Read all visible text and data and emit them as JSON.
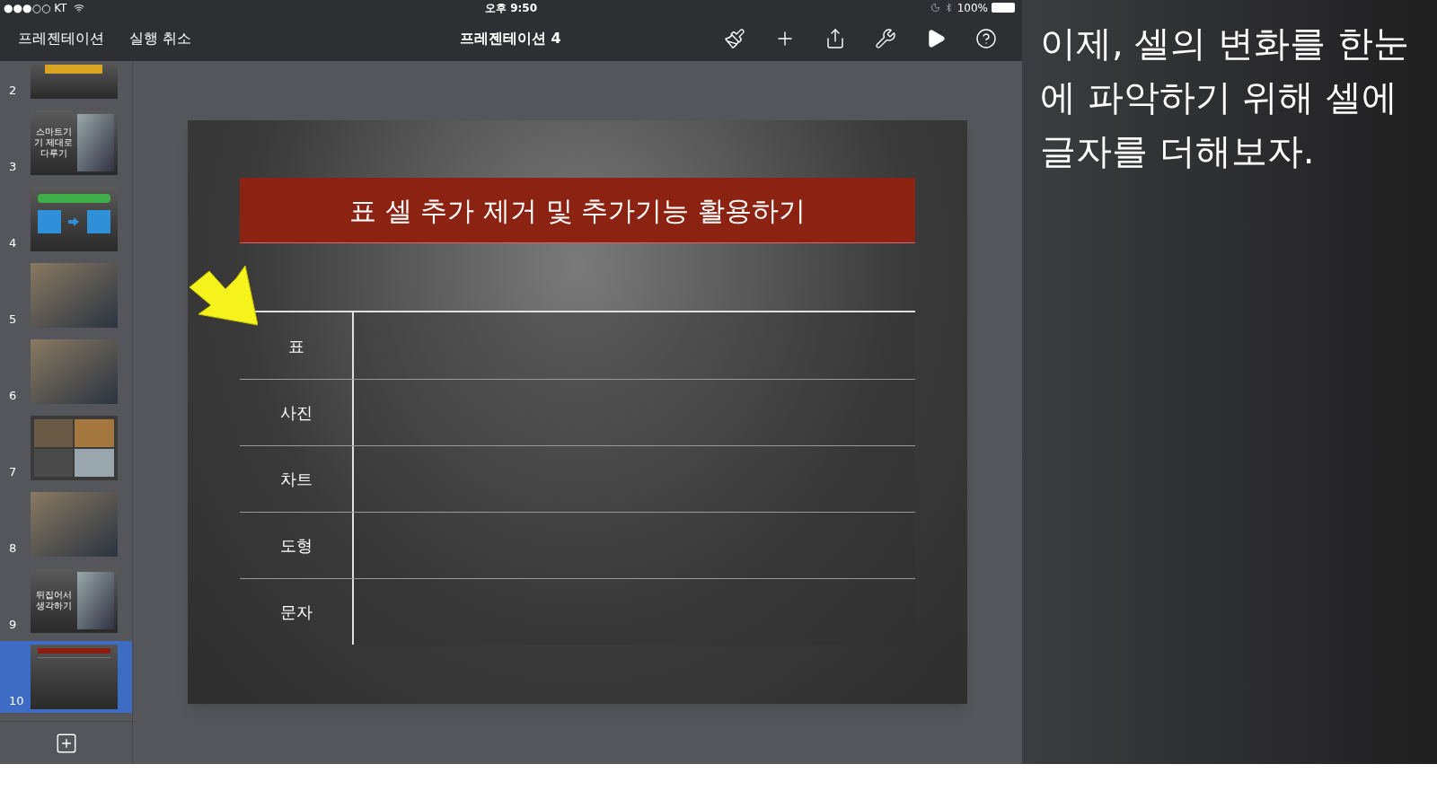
{
  "status_bar": {
    "carrier": "●●●○○ KT",
    "time": "오후 9:50",
    "battery": "100%"
  },
  "toolbar": {
    "back": "프레젠테이션",
    "undo": "실행 취소",
    "title": "프레젠테이션 4",
    "actions": [
      {
        "kind": "brush"
      },
      {
        "kind": "add"
      },
      {
        "kind": "share"
      },
      {
        "kind": "wrench"
      },
      {
        "kind": "play"
      },
      {
        "kind": "help"
      }
    ]
  },
  "slides": [
    {
      "number": "2",
      "kind": "photo-top",
      "selected": false
    },
    {
      "number": "3",
      "kind": "text-photo",
      "title": "스마트기기 제대로 다루기",
      "selected": false
    },
    {
      "number": "4",
      "kind": "diagram",
      "selected": false
    },
    {
      "number": "5",
      "kind": "photo",
      "selected": false
    },
    {
      "number": "6",
      "kind": "photo",
      "selected": false
    },
    {
      "number": "7",
      "kind": "collage",
      "selected": false
    },
    {
      "number": "8",
      "kind": "photo",
      "selected": false
    },
    {
      "number": "9",
      "kind": "text-photo",
      "title": "뒤집어서 생각하기",
      "selected": false
    },
    {
      "number": "10",
      "kind": "table",
      "selected": true
    }
  ],
  "slide": {
    "title": "표 셀 추가 제거 및 추가기능 활용하기",
    "rows": [
      "표",
      "사진",
      "차트",
      "도형",
      "문자"
    ]
  },
  "caption": "이제, 셀의 변화를 한눈에 파악하기 위해 셀에 글자를 더해보자."
}
